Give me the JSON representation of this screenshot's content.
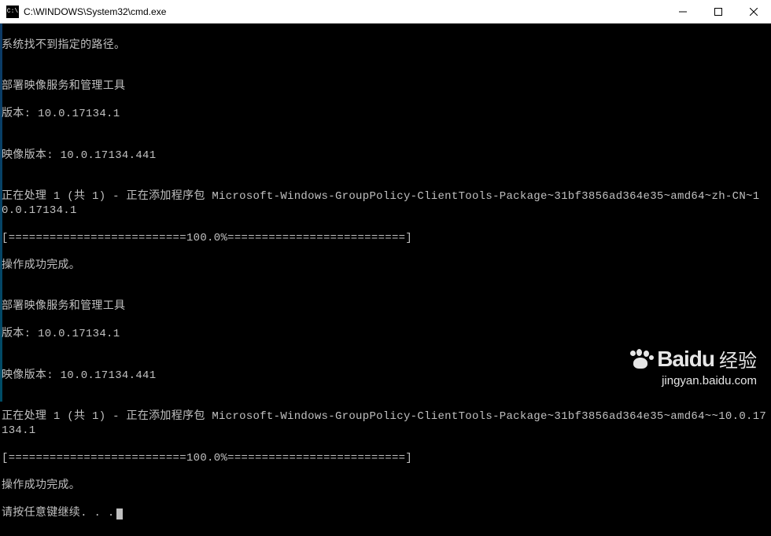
{
  "window": {
    "title": "C:\\WINDOWS\\System32\\cmd.exe"
  },
  "terminal": {
    "lines": [
      "系统找不到指定的路径。",
      "",
      "部署映像服务和管理工具",
      "版本: 10.0.17134.1",
      "",
      "映像版本: 10.0.17134.441",
      "",
      "正在处理 1 (共 1) - 正在添加程序包 Microsoft-Windows-GroupPolicy-ClientTools-Package~31bf3856ad364e35~amd64~zh-CN~10.0.17134.1",
      "[==========================100.0%==========================]",
      "操作成功完成。",
      "",
      "部署映像服务和管理工具",
      "版本: 10.0.17134.1",
      "",
      "映像版本: 10.0.17134.441",
      "",
      "正在处理 1 (共 1) - 正在添加程序包 Microsoft-Windows-GroupPolicy-ClientTools-Package~31bf3856ad364e35~amd64~~10.0.17134.1",
      "[==========================100.0%==========================]",
      "操作成功完成。",
      "请按任意键继续. . ."
    ]
  },
  "watermark": {
    "brand": "Bai",
    "brand_suffix": "du",
    "cn": "经验",
    "url": "jingyan.baidu.com"
  }
}
